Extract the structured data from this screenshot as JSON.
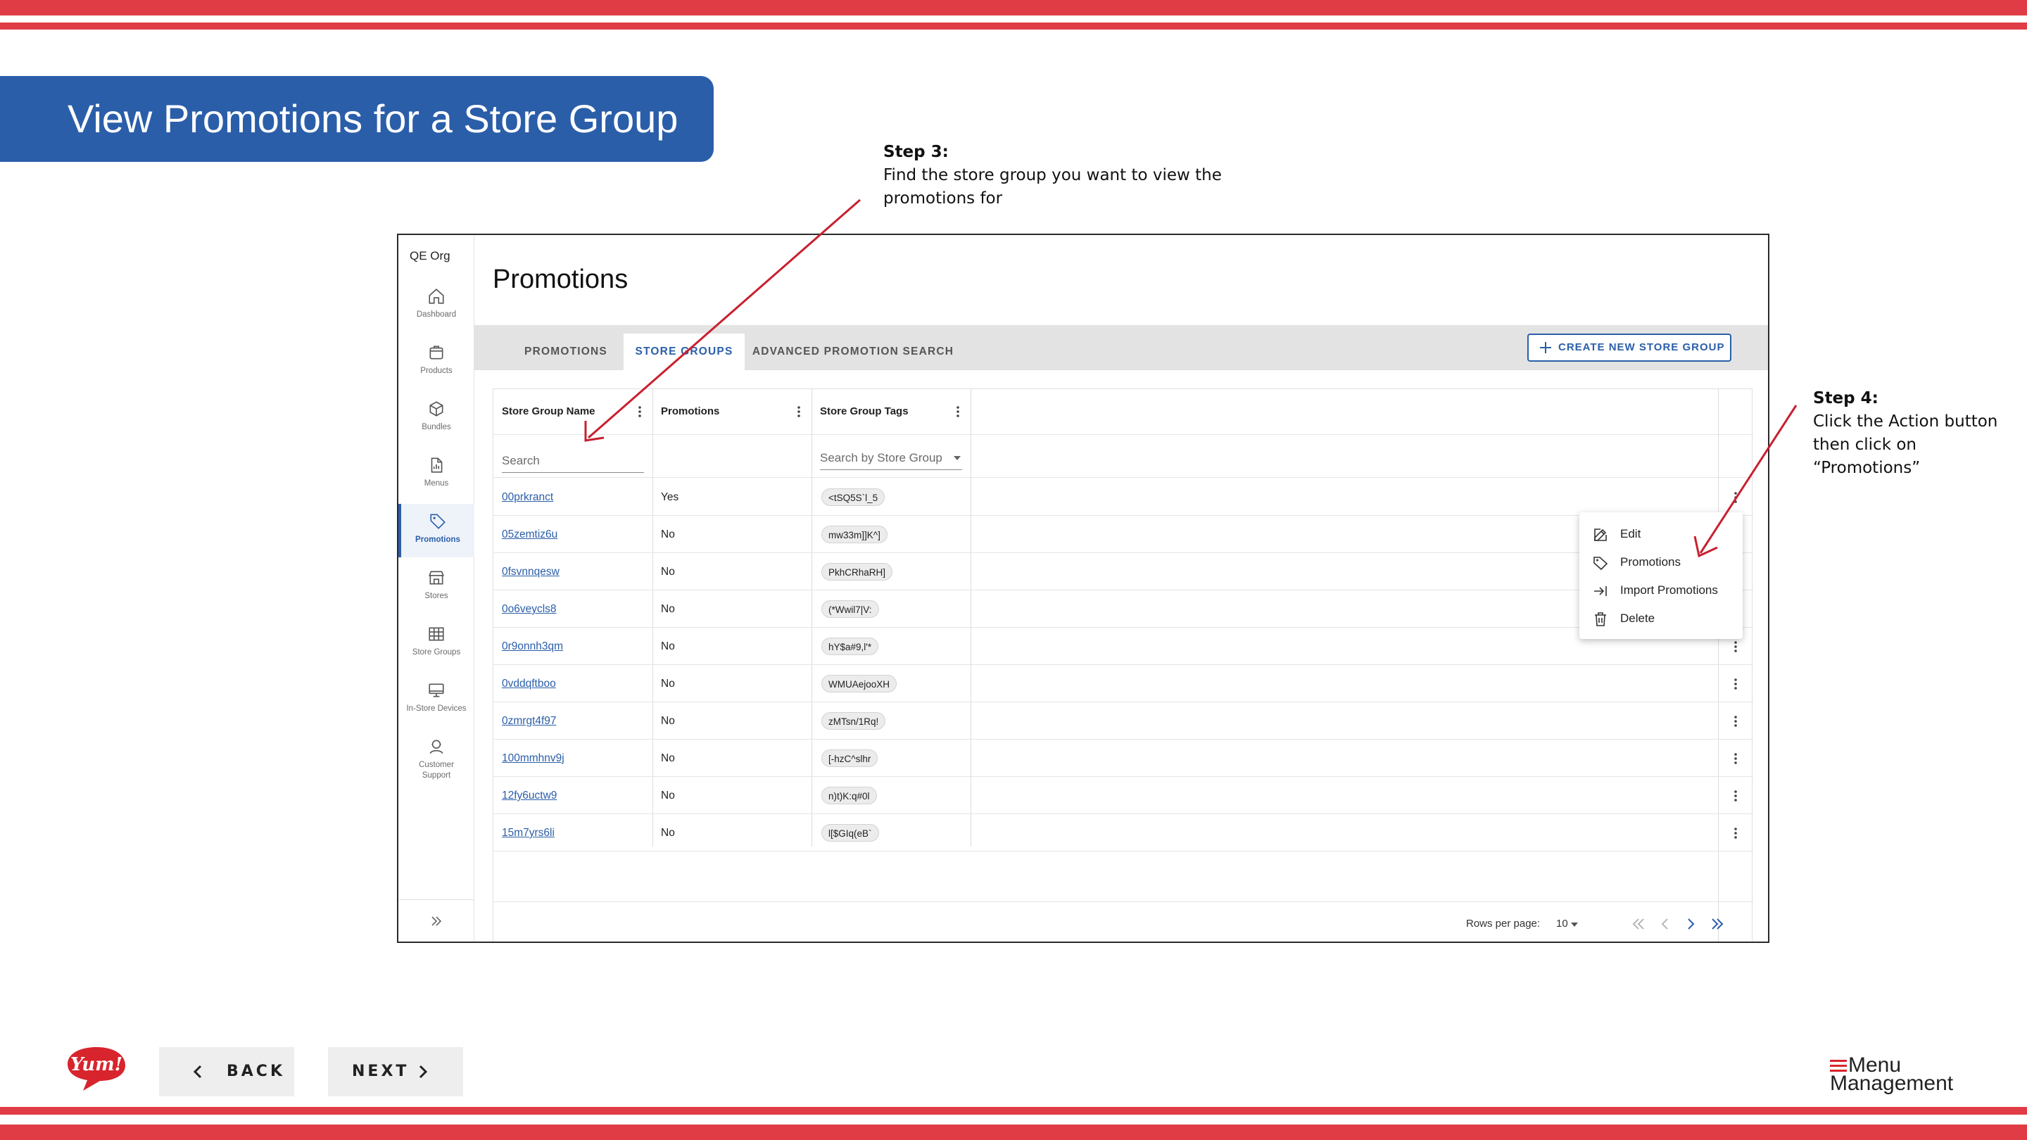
{
  "slide": {
    "title": "View Promotions for a Store Group",
    "step3": {
      "label": "Step 3:",
      "text": "Find the store group you want to view the promotions for"
    },
    "step4": {
      "label": "Step 4:",
      "text": "Click the Action button then click on “Promotions”"
    },
    "back_label": "BACK",
    "next_label": "NEXT",
    "brand_logo": "Yum!",
    "product_logo": {
      "line1": "Menu",
      "line2": "Management"
    },
    "colors": {
      "stripe": "#e03c45",
      "banner": "#2b5ea9",
      "accent": "#2b5ea9",
      "arrow": "#c8202f"
    }
  },
  "app": {
    "org_name": "QE Org",
    "sidebar": [
      {
        "label": "Dashboard",
        "icon": "home-icon"
      },
      {
        "label": "Products",
        "icon": "box-icon"
      },
      {
        "label": "Bundles",
        "icon": "cube-icon"
      },
      {
        "label": "Menus",
        "icon": "document-icon"
      },
      {
        "label": "Promotions",
        "icon": "tag-icon",
        "active": true
      },
      {
        "label": "Stores",
        "icon": "store-icon"
      },
      {
        "label": "Store Groups",
        "icon": "grid-icon"
      },
      {
        "label": "In-Store Devices",
        "icon": "monitor-icon"
      },
      {
        "label": "Customer Support",
        "icon": "support-icon"
      }
    ],
    "page_title": "Promotions",
    "tabs": [
      "PROMOTIONS",
      "STORE GROUPS",
      "ADVANCED PROMOTION SEARCH"
    ],
    "active_tab": "STORE GROUPS",
    "create_button": "CREATE NEW STORE GROUP",
    "table": {
      "columns": [
        "Store Group Name",
        "Promotions",
        "Store Group Tags"
      ],
      "search_placeholder": "Search",
      "tag_search_placeholder": "Search by Store Group",
      "rows": [
        {
          "name": "00prkranct",
          "promotions": "Yes",
          "tag": "<tSQ5S`l_5"
        },
        {
          "name": "05zemtiz6u",
          "promotions": "No",
          "tag": "mw33m]]K^]"
        },
        {
          "name": "0fsvnnqesw",
          "promotions": "No",
          "tag": "PkhCRhaRH]"
        },
        {
          "name": "0o6veycls8",
          "promotions": "No",
          "tag": "(*Wwil7|V:"
        },
        {
          "name": "0r9onnh3qm",
          "promotions": "No",
          "tag": "hY$a#9,l'*"
        },
        {
          "name": "0vddqftboo",
          "promotions": "No",
          "tag": "WMUAejooXH"
        },
        {
          "name": "0zmrgt4f97",
          "promotions": "No",
          "tag": "zMTsn/1Rq!"
        },
        {
          "name": "100mmhnv9j",
          "promotions": "No",
          "tag": "[-hzC^slhr"
        },
        {
          "name": "12fy6uctw9",
          "promotions": "No",
          "tag": "n)t)K:q#0l"
        },
        {
          "name": "15m7yrs6li",
          "promotions": "No",
          "tag": "l[$GIq(eB`"
        }
      ],
      "rows_per_page_label": "Rows per page:",
      "rows_per_page_value": "10"
    },
    "action_menu": [
      "Edit",
      "Promotions",
      "Import Promotions",
      "Delete"
    ]
  }
}
